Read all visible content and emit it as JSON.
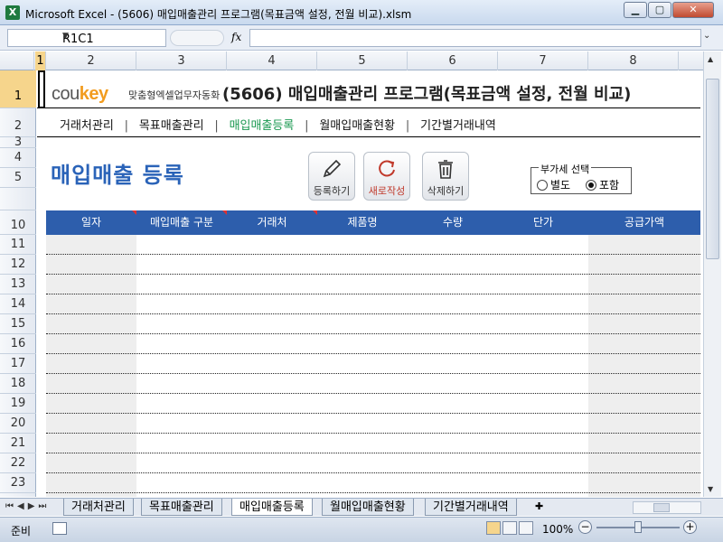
{
  "window": {
    "title": "Microsoft Excel - (5606) 매입매출관리 프로그램(목표금액 설정, 전월 비교).xlsm",
    "app_icon": "excel-icon"
  },
  "formula_bar": {
    "name_box": "R1C1",
    "fx_label": "fx",
    "formula": ""
  },
  "columns": [
    "1",
    "2",
    "3",
    "4",
    "5",
    "6",
    "7",
    "8"
  ],
  "rows": [
    "1",
    "2",
    "3",
    "4",
    "5",
    "10",
    "11",
    "12",
    "13",
    "14",
    "15",
    "16",
    "17",
    "18",
    "19",
    "20",
    "21",
    "22",
    "23"
  ],
  "sheet": {
    "brand_a": "cou",
    "brand_b": "key",
    "brand_sub": "맞춤형엑셀업무자동화",
    "program_title": "(5606) 매입매출관리 프로그램(목표금액 설정, 전월 비교)",
    "menu": [
      {
        "label": "거래처관리"
      },
      {
        "label": "목표매출관리"
      },
      {
        "label": "매입매출등록"
      },
      {
        "label": "월매입매출현황"
      },
      {
        "label": "기간별거래내역"
      }
    ],
    "menu_separator": "|",
    "page_heading": "매입매출 등록",
    "buttons": {
      "register": "등록하기",
      "new": "새로작성",
      "delete": "삭제하기"
    },
    "vat": {
      "legend": "부가세 선택",
      "option_separate": "별도",
      "option_included": "포함",
      "selected": "포함"
    },
    "table": {
      "headers": [
        "일자",
        "매입매출 구분",
        "거래처",
        "제품명",
        "수량",
        "단가",
        "공급가액"
      ]
    }
  },
  "tabs": [
    "거래처관리",
    "목표매출관리",
    "매입매출등록",
    "월매입매출현황",
    "기간별거래내역"
  ],
  "active_tab": "매입매출등록",
  "status": {
    "ready": "준비",
    "zoom": "100%"
  },
  "colors": {
    "accent_blue": "#2d5eac",
    "heading_blue": "#2a63b8",
    "active_menu_green": "#1a9850",
    "brand_orange": "#f29c1f"
  }
}
